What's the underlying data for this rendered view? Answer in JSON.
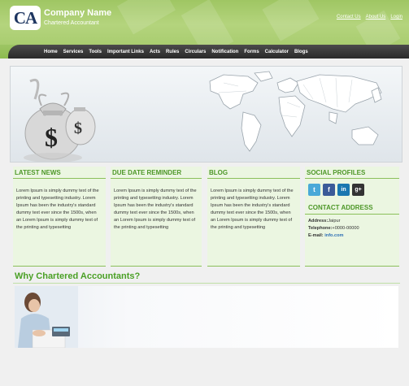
{
  "header": {
    "logo_text": "CA",
    "company_name": "Company Name",
    "tagline": "Chartered Accountant",
    "links": [
      "Contact Us",
      "About Us",
      "Login"
    ]
  },
  "nav": {
    "items": [
      "Home",
      "Services",
      "Tools",
      "Important Links",
      "Acts",
      "Rules",
      "Circulars",
      "Notification",
      "Forms",
      "Calculator",
      "Blogs"
    ]
  },
  "columns": {
    "latest_news": {
      "title": "LATEST NEWS",
      "text": "Lorem Ipsum is simply dummy text of the printing and typesetting industry. Lorem Ipsum has been the industry's standard dummy text ever since the 1500s, when an Lorem Ipsum is simply dummy text of the printing and typesetting"
    },
    "due_date": {
      "title": "DUE DATE REMINDER",
      "text": "Lorem Ipsum is simply dummy text of the printing and typesetting industry. Lorem Ipsum has been the industry's standard dummy text ever since the 1500s, when an Lorem Ipsum is simply dummy text of the printing and typesetting"
    },
    "blog": {
      "title": "BLOG",
      "text": "Lorem Ipsum is simply dummy text of the printing and typesetting industry. Lorem Ipsum has been the industry's standard dummy text ever since the 1500s, when an Lorem Ipsum is simply dummy text of the printing and typesetting"
    },
    "social": {
      "title": "SOCIAL PROFILES",
      "icons": [
        "twitter-icon",
        "facebook-icon",
        "linkedin-icon",
        "google-plus-icon"
      ],
      "icon_glyphs": [
        "t",
        "f",
        "in",
        "g+"
      ],
      "contact_title": "CONTACT ADDRESS",
      "address_label": "Address:",
      "address_value": "Jaipur",
      "phone_label": "Telephone:",
      "phone_value": "+0000-00000",
      "email_label": "E-mail:",
      "email_value": "info.com"
    }
  },
  "why": {
    "title": "Why Chartered Accountants?"
  },
  "colors": {
    "header_green": "#a9cd70",
    "nav_dark": "#333333",
    "accent_green": "#4d9728",
    "column_bg": "#ebf6e1",
    "link_blue": "#2d6fb5"
  }
}
